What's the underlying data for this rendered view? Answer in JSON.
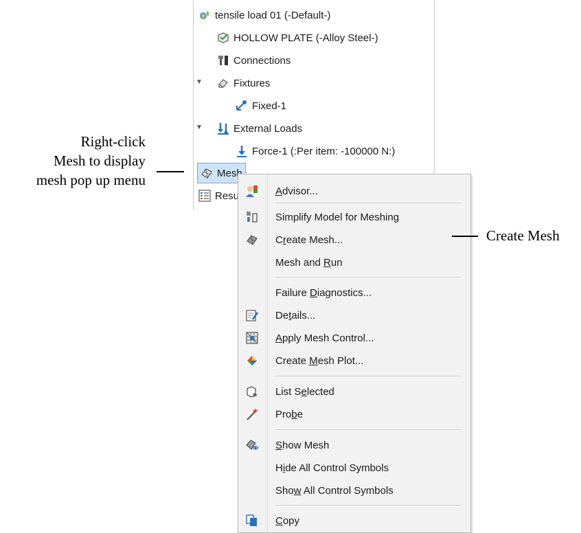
{
  "tree": {
    "items": [
      {
        "label": "tensile load 01 (-Default-)",
        "icon": "study-icon"
      },
      {
        "label": "HOLLOW PLATE (-Alloy Steel-)",
        "icon": "part-material-icon"
      },
      {
        "label": "Connections",
        "icon": "connections-icon"
      },
      {
        "label": "Fixtures",
        "icon": "fixtures-icon",
        "expanded": true
      },
      {
        "label": "Fixed-1",
        "icon": "fixed-icon"
      },
      {
        "label": "External Loads",
        "icon": "external-loads-icon",
        "expanded": true
      },
      {
        "label": "Force-1 (:Per item: -100000 N:)",
        "icon": "force-icon"
      },
      {
        "label": "Mesh",
        "icon": "mesh-icon",
        "selected": true
      },
      {
        "label": "Result",
        "icon": "results-icon"
      }
    ]
  },
  "menu": {
    "advisor": {
      "pre": "",
      "u": "A",
      "post": "dvisor...",
      "icon": "advisor-icon"
    },
    "simplify": {
      "pre": "Simplify Model for Meshing",
      "u": "",
      "post": "",
      "icon": "simplify-icon"
    },
    "create_mesh": {
      "pre": "C",
      "u": "r",
      "post": "eate Mesh...",
      "icon": "create-mesh-icon"
    },
    "mesh_run": {
      "pre": "Mesh and ",
      "u": "R",
      "post": "un"
    },
    "failure_diag": {
      "pre": "Failure ",
      "u": "D",
      "post": "iagnostics..."
    },
    "details": {
      "pre": "De",
      "u": "t",
      "post": "ails...",
      "icon": "details-icon"
    },
    "apply_control": {
      "pre": "",
      "u": "A",
      "post": "pply Mesh Control...",
      "icon": "mesh-control-icon"
    },
    "mesh_plot": {
      "pre": "Create ",
      "u": "M",
      "post": "esh Plot...",
      "icon": "mesh-plot-icon"
    },
    "list_selected": {
      "pre": "List S",
      "u": "e",
      "post": "lected",
      "icon": "list-selected-icon"
    },
    "probe": {
      "pre": "Pro",
      "u": "b",
      "post": "e",
      "icon": "probe-icon"
    },
    "show_mesh": {
      "pre": "",
      "u": "S",
      "post": "how Mesh",
      "icon": "show-mesh-icon"
    },
    "hide_symbols": {
      "pre": "H",
      "u": "i",
      "post": "de All Control Symbols"
    },
    "show_symbols": {
      "pre": "Sho",
      "u": "w",
      "post": " All Control Symbols"
    },
    "copy": {
      "pre": "",
      "u": "C",
      "post": "opy",
      "icon": "copy-icon"
    }
  },
  "annotations": {
    "right_click_line1": "Right-click",
    "right_click_line2": "Mesh to display",
    "right_click_line3": "mesh pop up menu",
    "create_mesh": "Create Mesh"
  },
  "colors": {
    "selection": "#cfe3f7",
    "menu_background": "#f2f2f2"
  }
}
